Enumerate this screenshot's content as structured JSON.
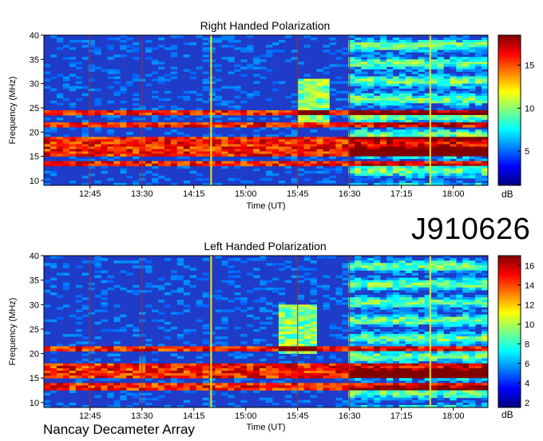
{
  "observation_id": "J910626",
  "instrument": "Nancay Decameter Array",
  "colors": {
    "marker_red": "#b0301a",
    "marker_yellow": "#ffe600",
    "background_blue": "#1e3cc8"
  },
  "chart_data": [
    {
      "type": "heatmap",
      "title": "Right Handed Polarization",
      "xlabel": "Time (UT)",
      "ylabel": "Frequency (MHz)",
      "x_ticks": [
        "12:45",
        "13:30",
        "14:15",
        "15:00",
        "15:45",
        "16:30",
        "17:15",
        "18:00"
      ],
      "y_ticks": [
        10,
        15,
        20,
        25,
        30,
        35,
        40
      ],
      "xlim": [
        "12:05",
        "18:30"
      ],
      "ylim": [
        9,
        40
      ],
      "colorbar": {
        "label": "dB",
        "ticks": [
          5,
          10,
          15
        ],
        "range": [
          1,
          18.5
        ],
        "colormap": "jet"
      },
      "marker_lines_red_ut": [
        "12:45",
        "13:30",
        "15:45",
        "16:30"
      ],
      "marker_lines_yellow_ut": [
        "14:30",
        "17:40"
      ],
      "strong_emission_bands_mhz": [
        [
          13,
          14
        ],
        [
          15,
          19
        ],
        [
          21,
          22
        ],
        [
          23.5,
          24.5
        ]
      ],
      "burst": {
        "time_ut": "16:00",
        "freq_range_mhz": [
          22,
          31
        ]
      }
    },
    {
      "type": "heatmap",
      "title": "Left Handed Polarization",
      "xlabel": "Time (UT)",
      "ylabel": "Frequency (MHz)",
      "x_ticks": [
        "12:45",
        "13:30",
        "14:15",
        "15:00",
        "15:45",
        "16:30",
        "17:15",
        "18:00"
      ],
      "y_ticks": [
        10,
        15,
        20,
        25,
        30,
        35,
        40
      ],
      "xlim": [
        "12:05",
        "18:30"
      ],
      "ylim": [
        9,
        40
      ],
      "colorbar": {
        "label": "dB",
        "ticks": [
          2,
          4,
          6,
          8,
          10,
          12,
          14,
          16
        ],
        "range": [
          1.5,
          17
        ],
        "colormap": "jet"
      },
      "marker_lines_red_ut": [
        "12:45",
        "13:30",
        "15:45",
        "16:30"
      ],
      "marker_lines_yellow_ut": [
        "14:30",
        "17:40"
      ],
      "strong_emission_bands_mhz": [
        [
          12.5,
          14
        ],
        [
          15,
          18
        ],
        [
          20.5,
          21.5
        ]
      ],
      "burst": {
        "time_ut": "15:45",
        "freq_range_mhz": [
          20,
          30
        ]
      }
    }
  ]
}
